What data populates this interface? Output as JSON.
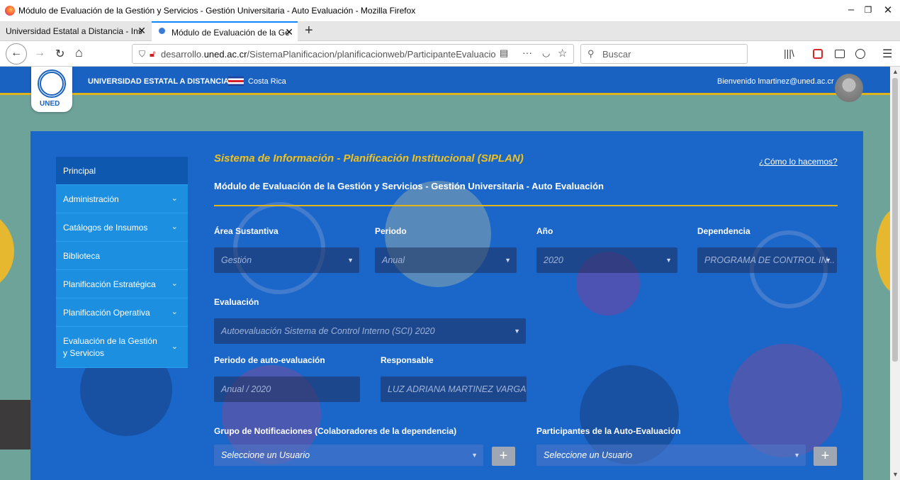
{
  "window": {
    "title": "Módulo de Evaluación de la Gestión y Servicios - Gestión Universitaria - Auto Evaluación - Mozilla Firefox",
    "minimize": "–",
    "restore": "❐",
    "close": "✕"
  },
  "tabs": [
    {
      "label": "Universidad Estatal a Distancia - Ins",
      "close": "✕"
    },
    {
      "label": "Módulo de Evaluación de la Ge",
      "close": "✕"
    }
  ],
  "new_tab": "+",
  "nav": {
    "back": "←",
    "forward": "→",
    "reload": "↻",
    "home": "⌂",
    "url_prefix": "desarrollo.",
    "url_domain": "uned.ac.cr",
    "url_path": "/SistemaPlanificacion/planificacionweb/ParticipanteEvaluacio",
    "search_placeholder": "Buscar",
    "menu": "☰",
    "more": "···",
    "bookmark": "☆"
  },
  "header": {
    "university": "UNIVERSIDAD ESTATAL A DISTANCIA",
    "country": "Costa Rica",
    "welcome": "Bienvenido lmartinez@uned.ac.cr",
    "logo_text": "UNED"
  },
  "sidebar": {
    "items": [
      {
        "label": "Principal",
        "chevron": ""
      },
      {
        "label": "Administración",
        "chevron": "⌄"
      },
      {
        "label": "Catálogos de Insumos",
        "chevron": "⌄"
      },
      {
        "label": "Biblioteca",
        "chevron": ""
      },
      {
        "label": "Planificación Estratégica",
        "chevron": "⌄"
      },
      {
        "label": "Planificación Operativa",
        "chevron": "⌄"
      },
      {
        "label": "Evaluación de la Gestión y Servicios",
        "chevron": "⌄"
      }
    ]
  },
  "main": {
    "system_title": "Sistema de Información - Planificación Institucional (SIPLAN)",
    "help_link": "¿Cómo lo hacemos?",
    "module_title": "Módulo de Evaluación de la Gestión y Servicios - Gestión Universitaria - Auto Evaluación",
    "area_label": "Área Sustantiva",
    "area_value": "Gestión",
    "periodo_label": "Periodo",
    "periodo_value": "Anual",
    "anio_label": "Año",
    "anio_value": "2020",
    "dependencia_label": "Dependencia",
    "dependencia_value": "PROGRAMA DE CONTROL IN...",
    "evaluacion_label": "Evaluación",
    "evaluacion_value": "Autoevaluación Sistema de Control Interno (SCI) 2020",
    "periodo_auto_label": "Periodo de auto-evaluación",
    "periodo_auto_value": "Anual / 2020",
    "responsable_label": "Responsable",
    "responsable_value": "LUZ ADRIANA MARTINEZ VARGAS",
    "grupo_label": "Grupo de Notificaciones (Colaboradores de la dependencia)",
    "grupo_placeholder": "Seleccione un Usuario",
    "participantes_label": "Participantes de la Auto-Evaluación",
    "participantes_placeholder": "Seleccione un Usuario",
    "add": "+",
    "caret": "▼"
  },
  "colors": {
    "header_blue": "#1a62c2",
    "accent_yellow": "#e2b41b",
    "sidebar_blue": "#1c8fe0"
  }
}
